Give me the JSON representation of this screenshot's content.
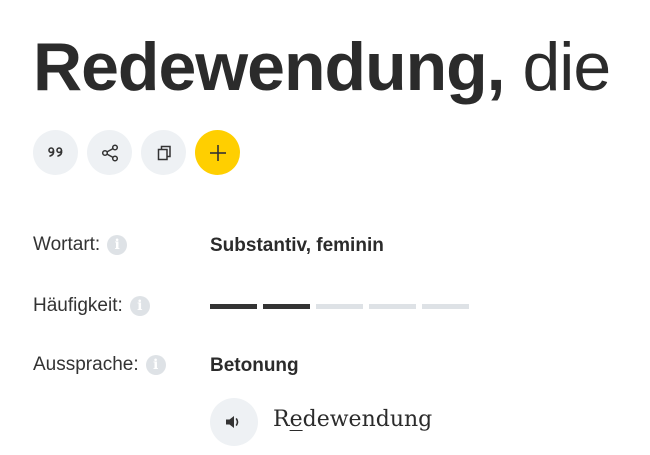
{
  "headword": {
    "word": "Redewendung,",
    "article": "die"
  },
  "actions": [
    {
      "name": "quote-button",
      "icon": "quote-icon"
    },
    {
      "name": "share-button",
      "icon": "share-icon"
    },
    {
      "name": "copy-button",
      "icon": "copy-icon"
    },
    {
      "name": "add-button",
      "icon": "plus-icon"
    }
  ],
  "colors": {
    "accent": "#ffcf00",
    "button_bg": "#eef1f4",
    "text": "#333333",
    "muted": "#dee2e6"
  },
  "details": {
    "wortart": {
      "label": "Wortart:",
      "value": "Substantiv, feminin"
    },
    "haeufigkeit": {
      "label": "Häufigkeit:",
      "level": 2,
      "max": 5
    },
    "aussprache": {
      "label": "Aussprache:",
      "value": "Betonung",
      "pronunciation": {
        "before": "R",
        "stressed": "e",
        "after": "dewendung"
      }
    }
  },
  "info_glyph": "i"
}
